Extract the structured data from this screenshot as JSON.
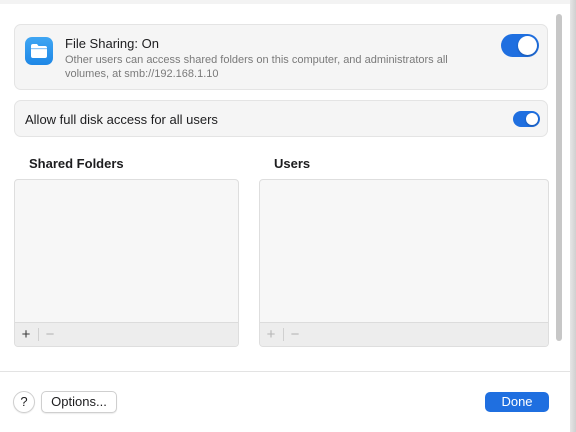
{
  "file_sharing": {
    "title": "File Sharing: On",
    "description": "Other users can access shared folders on this computer, and administrators all volumes, at smb://192.168.1.10",
    "toggle_on": true,
    "icon": "folder-icon"
  },
  "full_disk_access": {
    "label": "Allow full disk access for all users",
    "toggle_on": true
  },
  "shared_folders": {
    "title": "Shared Folders",
    "items": [],
    "add_label": "+",
    "remove_label": "−"
  },
  "users": {
    "title": "Users",
    "items": [],
    "add_label": "+",
    "remove_label": "−"
  },
  "footer": {
    "help_label": "?",
    "options_label": "Options...",
    "done_label": "Done"
  },
  "colors": {
    "accent": "#1f6fe0",
    "folder_icon": "#2f96ee"
  }
}
